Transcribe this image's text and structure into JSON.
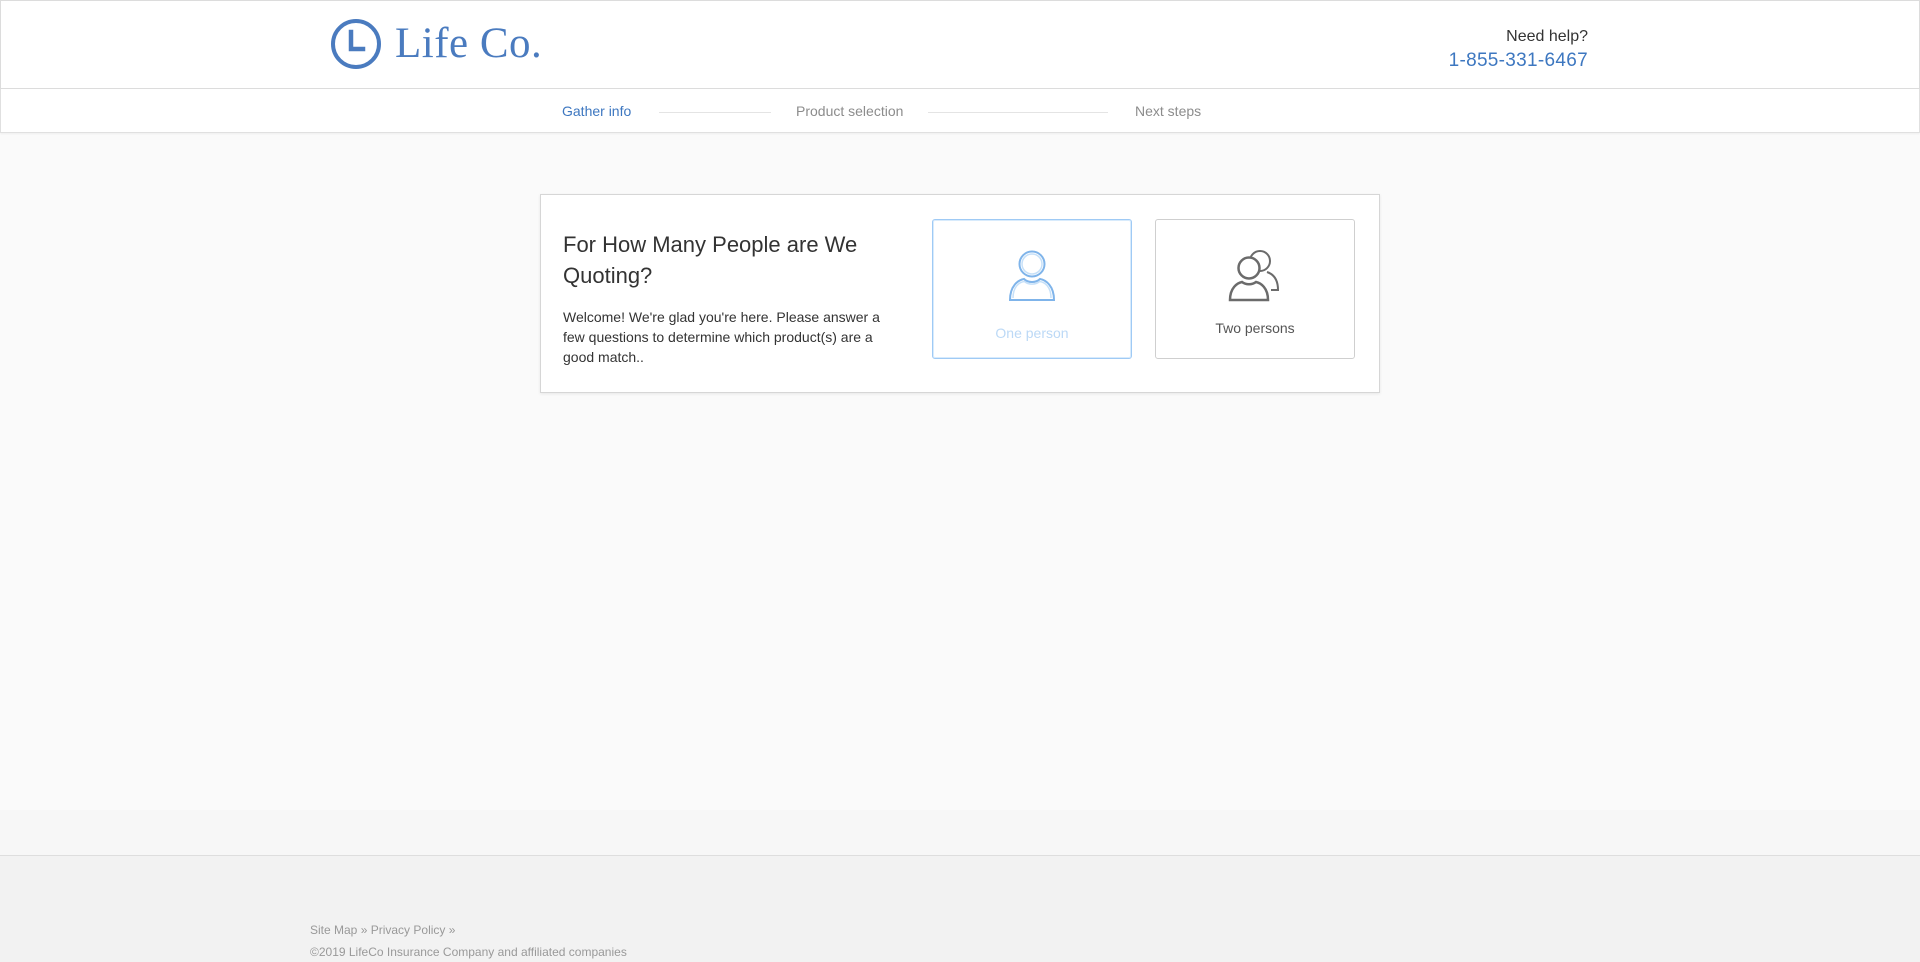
{
  "header": {
    "brand": "Life Co.",
    "help_label": "Need help?",
    "help_phone": "1-855-331-6467"
  },
  "progress": {
    "steps": [
      {
        "label": "Gather info",
        "active": true
      },
      {
        "label": "Product selection",
        "active": false
      },
      {
        "label": "Next steps",
        "active": false
      }
    ]
  },
  "card": {
    "title": "For How Many People are We Quoting?",
    "description": "Welcome! We're glad you're here. Please answer a few questions to determine which product(s) are a good match..",
    "options": [
      {
        "label": "One person",
        "icon": "person-icon",
        "selected": true
      },
      {
        "label": "Two persons",
        "icon": "two-persons-icon",
        "selected": false
      }
    ]
  },
  "footer": {
    "links": [
      "Site Map »",
      "Privacy Policy »"
    ],
    "copyright": "©2019 LifeCo Insurance Company and affiliated companies"
  },
  "colors": {
    "brand": "#4a7bbf",
    "link": "#3d77c0",
    "selected_border": "#9fcaf5",
    "muted": "#8c8c8c"
  }
}
